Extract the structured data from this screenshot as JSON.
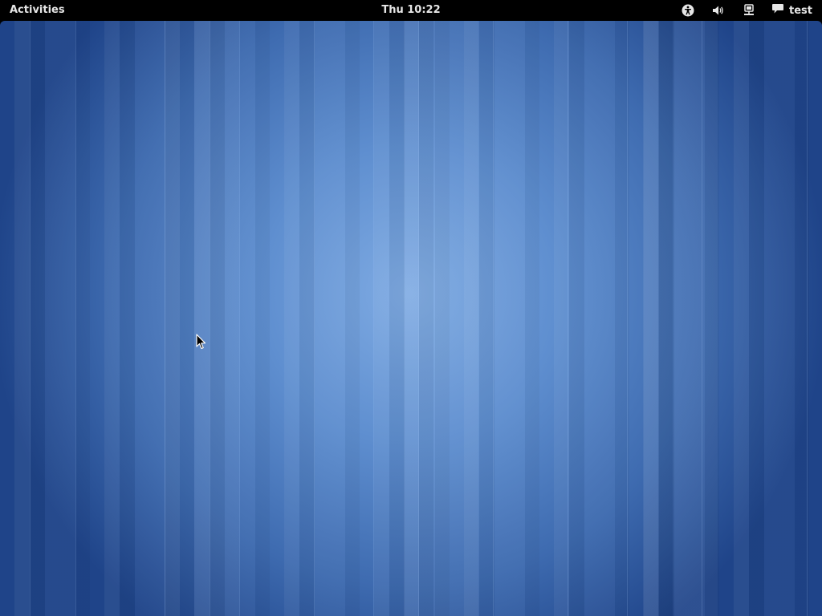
{
  "top_bar": {
    "activities_label": "Activities",
    "clock": "Thu 10:22",
    "status_icons": [
      "accessibility-icon",
      "volume-icon",
      "network-icon"
    ],
    "user_icon": "chat-bubble-icon",
    "user_name": "test"
  },
  "colors": {
    "panel_background": "#000000",
    "panel_text": "#e6e6e6",
    "wallpaper_center": "#7fabe3",
    "wallpaper_edge": "#1f4489"
  }
}
